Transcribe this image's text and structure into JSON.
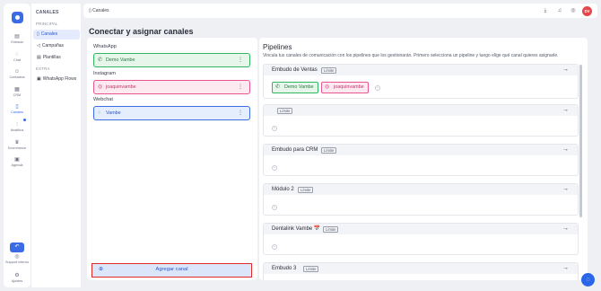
{
  "rail": {
    "items": [
      {
        "icon": "inbox-icon",
        "glyph": "▤",
        "label": "Entrada"
      },
      {
        "icon": "chat-icon",
        "glyph": "◌",
        "label": "Chat"
      },
      {
        "icon": "contacts-icon",
        "glyph": "☺",
        "label": "Contactos"
      },
      {
        "icon": "crm-icon",
        "glyph": "▦",
        "label": "CRM"
      },
      {
        "icon": "channels-icon",
        "glyph": "▯",
        "label": "Canales"
      },
      {
        "icon": "analytics-icon",
        "glyph": "⫶",
        "label": "Analítica"
      },
      {
        "icon": "ecommerce-icon",
        "glyph": "♛",
        "label": "Ecommerce"
      },
      {
        "icon": "agenda-icon",
        "glyph": "▣",
        "label": "Agenda"
      }
    ],
    "bottom": [
      {
        "icon": "support-icon",
        "glyph": "◎",
        "label": "Support interno"
      },
      {
        "icon": "settings-icon",
        "glyph": "⚙",
        "label": "Ajustes"
      }
    ]
  },
  "sidebar": {
    "title": "CANALES",
    "section_main": "PRINCIPAL",
    "items": [
      {
        "icon": "channels-icon",
        "glyph": "▯",
        "label": "Canales"
      },
      {
        "icon": "megaphone-icon",
        "glyph": "◁",
        "label": "Campañas"
      },
      {
        "icon": "template-icon",
        "glyph": "▤",
        "label": "Plantillas"
      }
    ],
    "section_extra": "EXTRA",
    "extra_items": [
      {
        "icon": "flows-icon",
        "glyph": "▣",
        "label": "WhatsApp Flows"
      }
    ]
  },
  "topbar": {
    "breadcrumb_icon": "▯",
    "breadcrumb": "Canales",
    "avatar": "DV"
  },
  "page": {
    "title": "Conectar y asignar canales"
  },
  "channels": {
    "groups": [
      {
        "name": "WhatsApp",
        "channel": "Demo Vambe",
        "glyph": "✆"
      },
      {
        "name": "Instagram",
        "channel": "joaquinvambe",
        "glyph": "◎"
      },
      {
        "name": "Webchat",
        "channel": "Vambe",
        "glyph": "◌"
      }
    ],
    "add_button": "Agregar canal"
  },
  "pipelines": {
    "title": "Pipelines",
    "subtitle": "Vincula tus canales de comunicación con los pipelines que los gestionarán. Primero selecciona un pipeline y luego elige qué canal quieres asignarle.",
    "badge": "Límite",
    "items": [
      {
        "name": "Embudo de Ventas",
        "tags": [
          {
            "kind": "whatsapp",
            "label": "Demo Vambe"
          },
          {
            "kind": "instagram",
            "label": "joaquinvambe"
          }
        ]
      },
      {
        "name": "",
        "tags": []
      },
      {
        "name": "Embudo para CRM",
        "tags": []
      },
      {
        "name": "Módulo 2",
        "tags": []
      },
      {
        "name": "Dentalink Vambe 📅",
        "tags": []
      },
      {
        "name": "Embudo 3",
        "tags": []
      }
    ]
  },
  "colors": {
    "accent": "#3c6be6",
    "whatsapp": "#33b661",
    "instagram": "#e8558f",
    "highlight": "#e02a2a"
  }
}
